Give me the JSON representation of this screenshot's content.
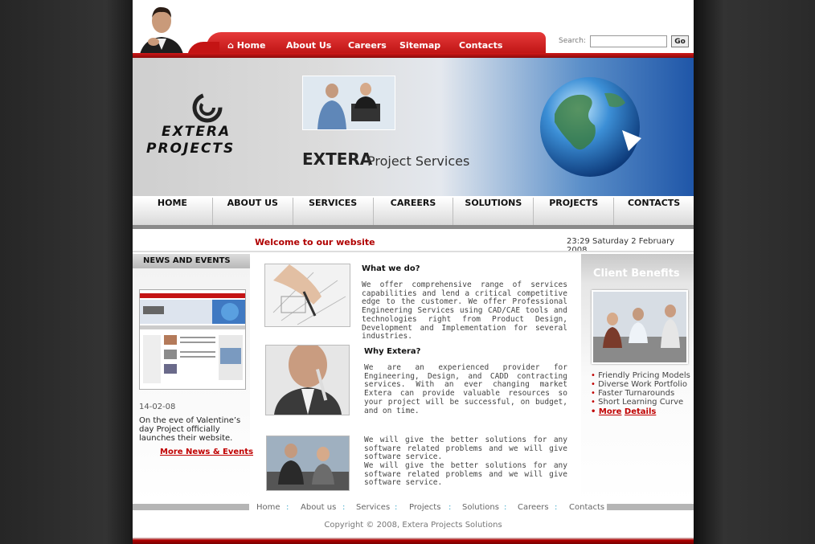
{
  "header": {
    "nav": [
      "Home",
      "About Us",
      "Careers",
      "Sitemap",
      "Contacts"
    ],
    "search_label": "Search:",
    "search_value": "",
    "go_label": "Go"
  },
  "banner": {
    "logo_line1": "EXTERA",
    "logo_line2": "PROJECTS",
    "title_bold": "EXTERA",
    "title_rest": "Project Services"
  },
  "main_nav": [
    "HOME",
    "ABOUT US",
    "SERVICES",
    "CAREERS",
    "SOLUTIONS",
    "PROJECTS",
    "CONTACTS"
  ],
  "welcome": "Welcome to our website",
  "datetime": "23:29  Saturday 2 February 2008",
  "news": {
    "header": "NEWS AND EVENTS",
    "date": "14-02-08",
    "text": "On the eve of Valentine’s day Project officially launches their website.",
    "more": "More News & Events"
  },
  "content": [
    {
      "heading": "What we do?",
      "text": "We offer comprehensive range of services capabilities and lend a critical competitive edge to the customer. We offer Professional Engineering Services using CAD/CAE tools and technologies right from Product Design, Development and Implementation for several industries."
    },
    {
      "heading": "Why Extera?",
      "text": "We are an experienced provider for Engineering, Design, and CADD contracting services. With an ever changing market Extera can provide valuable resources so your project will be successful, on budget, and on time."
    },
    {
      "heading": "",
      "text1": "We will give the better solutions for any software related problems and we will give software service.",
      "text2": "We will give the better solutions for any software related problems and we will give software service."
    }
  ],
  "benefits": {
    "title": "Client Benefits",
    "items": [
      "Friendly Pricing Models",
      "Diverse Work Portfolio",
      "Faster Turnarounds",
      "Short Learning Curve"
    ],
    "more": "More",
    "details": "Details"
  },
  "footer": {
    "links": [
      "Home",
      "About us",
      "Services",
      "Projects",
      "Solutions",
      "Careers",
      "Contacts"
    ],
    "sep": ":",
    "copyright": "Copyright © 2008, Extera Projects Solutions"
  },
  "colors": {
    "brand_red": "#c41414",
    "background": "#2a2a2a",
    "globe_blue": "#1f56a8"
  }
}
